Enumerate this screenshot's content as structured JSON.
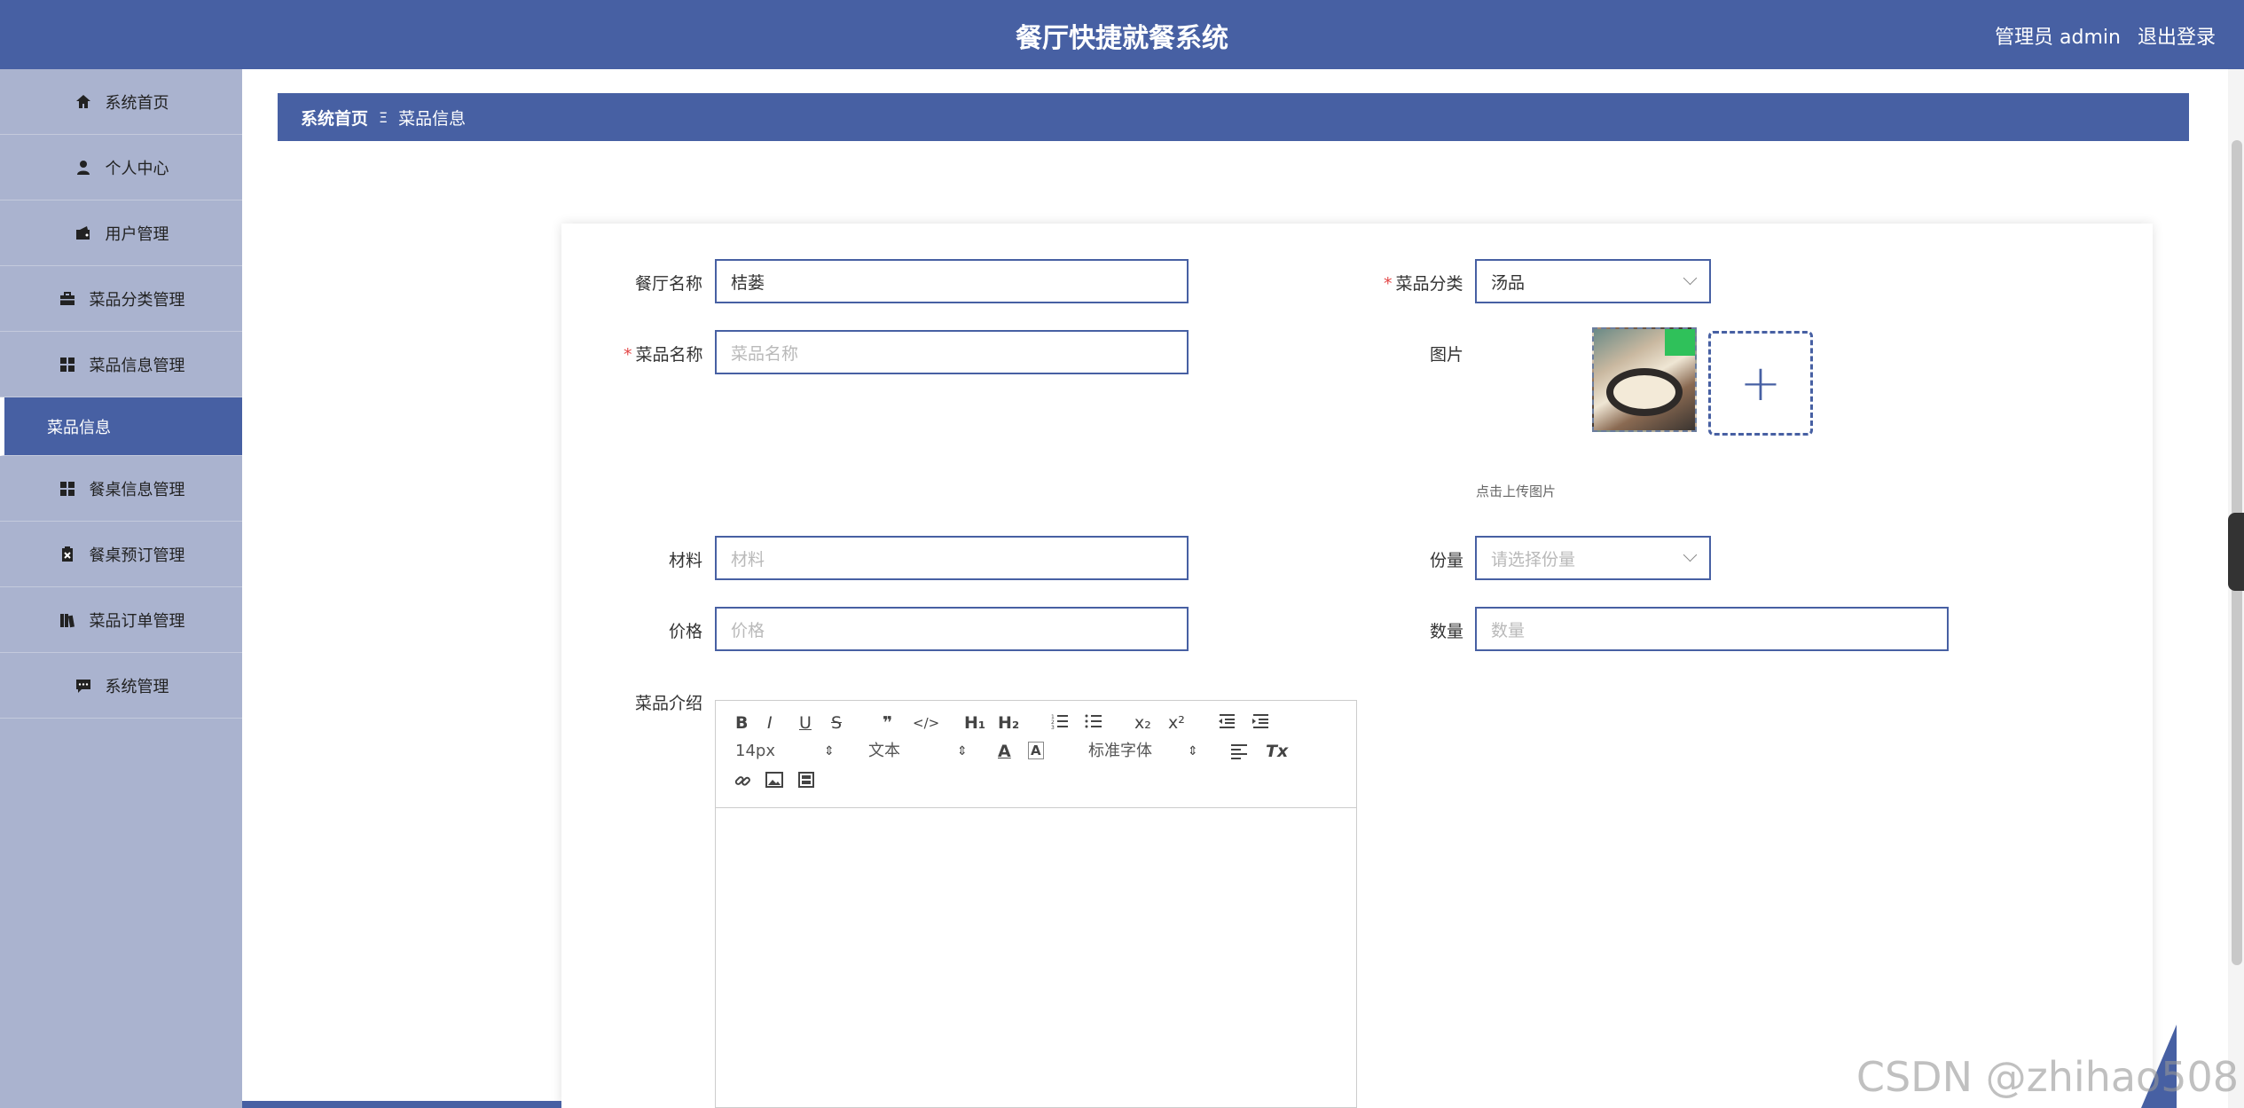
{
  "header": {
    "title": "餐厅快捷就餐系统",
    "user": "管理员 admin",
    "logout": "退出登录"
  },
  "sidebar": {
    "items": [
      {
        "label": "系统首页",
        "icon": "home-icon"
      },
      {
        "label": "个人中心",
        "icon": "person-icon"
      },
      {
        "label": "用户管理",
        "icon": "wallet-icon"
      },
      {
        "label": "菜品分类管理",
        "icon": "briefcase-icon"
      },
      {
        "label": "菜品信息管理",
        "icon": "grid-icon"
      },
      {
        "label": "菜品信息",
        "icon": ""
      },
      {
        "label": "餐桌信息管理",
        "icon": "grid-icon"
      },
      {
        "label": "餐桌预订管理",
        "icon": "clipboard-icon"
      },
      {
        "label": "菜品订单管理",
        "icon": "books-icon"
      },
      {
        "label": "系统管理",
        "icon": "chat-icon"
      }
    ]
  },
  "breadcrumb": {
    "home": "系统首页",
    "separator": "Ξ",
    "current": "菜品信息"
  },
  "form": {
    "restaurant_name": {
      "label": "餐厅名称",
      "value": "桔蒌"
    },
    "category": {
      "label": "菜品分类",
      "value": "汤品"
    },
    "dish_name": {
      "label": "菜品名称",
      "placeholder": "菜品名称"
    },
    "image": {
      "label": "图片",
      "hint": "点击上传图片",
      "add": "+"
    },
    "material": {
      "label": "材料",
      "placeholder": "材料"
    },
    "portion": {
      "label": "份量",
      "placeholder": "请选择份量"
    },
    "price": {
      "label": "价格",
      "placeholder": "价格"
    },
    "quantity": {
      "label": "数量",
      "placeholder": "数量"
    },
    "intro": {
      "label": "菜品介绍"
    }
  },
  "required_mark": "*",
  "editor": {
    "font_size": "14px",
    "block_type": "文本",
    "font_family": "标准字体",
    "buttons": {
      "bold": "B",
      "italic": "I",
      "underline": "U",
      "strike": "S",
      "quote": "❞",
      "code": "</>",
      "h1": "H₁",
      "h2": "H₂",
      "sub": "x₂",
      "sup": "x²",
      "clear": "Tx"
    }
  },
  "watermark": "CSDN @zhihao508",
  "colors": {
    "primary": "#4760a3",
    "sidebar": "#aab3cf",
    "required": "#e34646"
  }
}
